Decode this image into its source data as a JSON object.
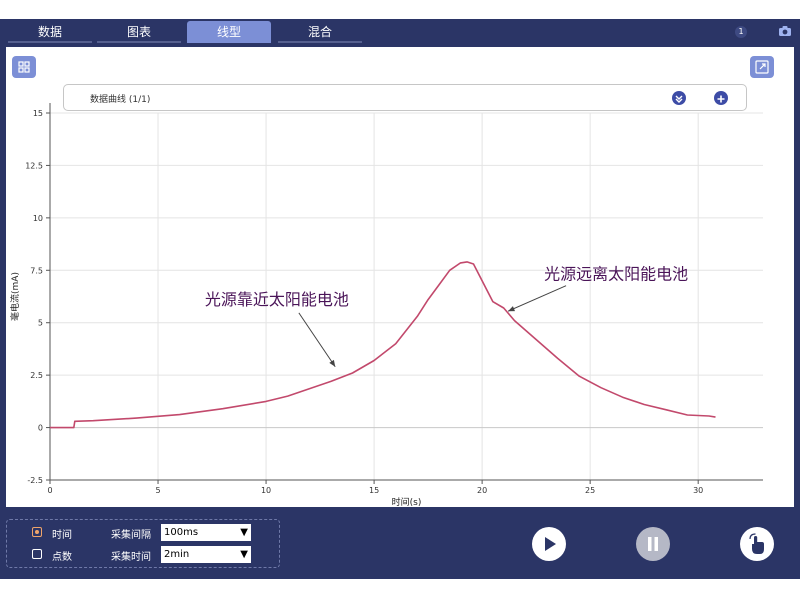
{
  "tabs": [
    {
      "label": "数据",
      "active": false
    },
    {
      "label": "图表",
      "active": false
    },
    {
      "label": "线型",
      "active": true
    },
    {
      "label": "混合",
      "active": false
    }
  ],
  "badge_count": "1",
  "curve_selector": {
    "label": "数据曲线 (1/1)"
  },
  "chart_data": {
    "type": "line",
    "title": "",
    "xlabel": "时间(s)",
    "ylabel": "毫电流(mA)",
    "xlim": [
      0,
      33
    ],
    "ylim": [
      -2.5,
      15
    ],
    "x_ticks": [
      0,
      5,
      10,
      15,
      20,
      25,
      30
    ],
    "y_ticks": [
      -2.5,
      0,
      2.5,
      5,
      7.5,
      10,
      12.5,
      15
    ],
    "grid": true,
    "series": [
      {
        "color": "#c2496c",
        "points": [
          [
            0,
            0
          ],
          [
            1.1,
            0
          ],
          [
            1.15,
            0.3
          ],
          [
            2,
            0.33
          ],
          [
            4,
            0.45
          ],
          [
            6,
            0.62
          ],
          [
            8,
            0.9
          ],
          [
            10,
            1.25
          ],
          [
            11,
            1.5
          ],
          [
            12,
            1.85
          ],
          [
            13,
            2.2
          ],
          [
            14,
            2.6
          ],
          [
            15,
            3.2
          ],
          [
            16,
            4.0
          ],
          [
            17,
            5.3
          ],
          [
            17.5,
            6.1
          ],
          [
            18,
            6.8
          ],
          [
            18.5,
            7.5
          ],
          [
            19,
            7.85
          ],
          [
            19.3,
            7.9
          ],
          [
            19.6,
            7.8
          ],
          [
            20,
            7.0
          ],
          [
            20.5,
            6.0
          ],
          [
            21,
            5.7
          ],
          [
            21.5,
            5.1
          ],
          [
            22.5,
            4.2
          ],
          [
            23.5,
            3.3
          ],
          [
            24.5,
            2.45
          ],
          [
            25.5,
            1.9
          ],
          [
            26.5,
            1.45
          ],
          [
            27.5,
            1.1
          ],
          [
            28.5,
            0.85
          ],
          [
            29.5,
            0.6
          ],
          [
            30.5,
            0.55
          ],
          [
            30.8,
            0.5
          ]
        ]
      }
    ],
    "annotations": [
      {
        "text": "光源靠近太阳能电池",
        "point": [
          13.2,
          2.9
        ],
        "label_at": [
          10.5,
          5.85
        ]
      },
      {
        "text": "光源远离太阳能电池",
        "point": [
          21.2,
          5.55
        ],
        "label_at": [
          26.2,
          7.05
        ]
      }
    ]
  },
  "settings": {
    "option_time": "时间",
    "option_points": "点数",
    "interval_label": "采集间隔",
    "interval_value": "100ms",
    "duration_label": "采集时间",
    "duration_value": "2min",
    "selected": "time"
  },
  "colors": {
    "app_bg": "#2b3566",
    "accent": "#7c8fd6",
    "curve": "#c2496c",
    "play_button": "#ffffff",
    "pause_button": "#b5b8c6"
  }
}
